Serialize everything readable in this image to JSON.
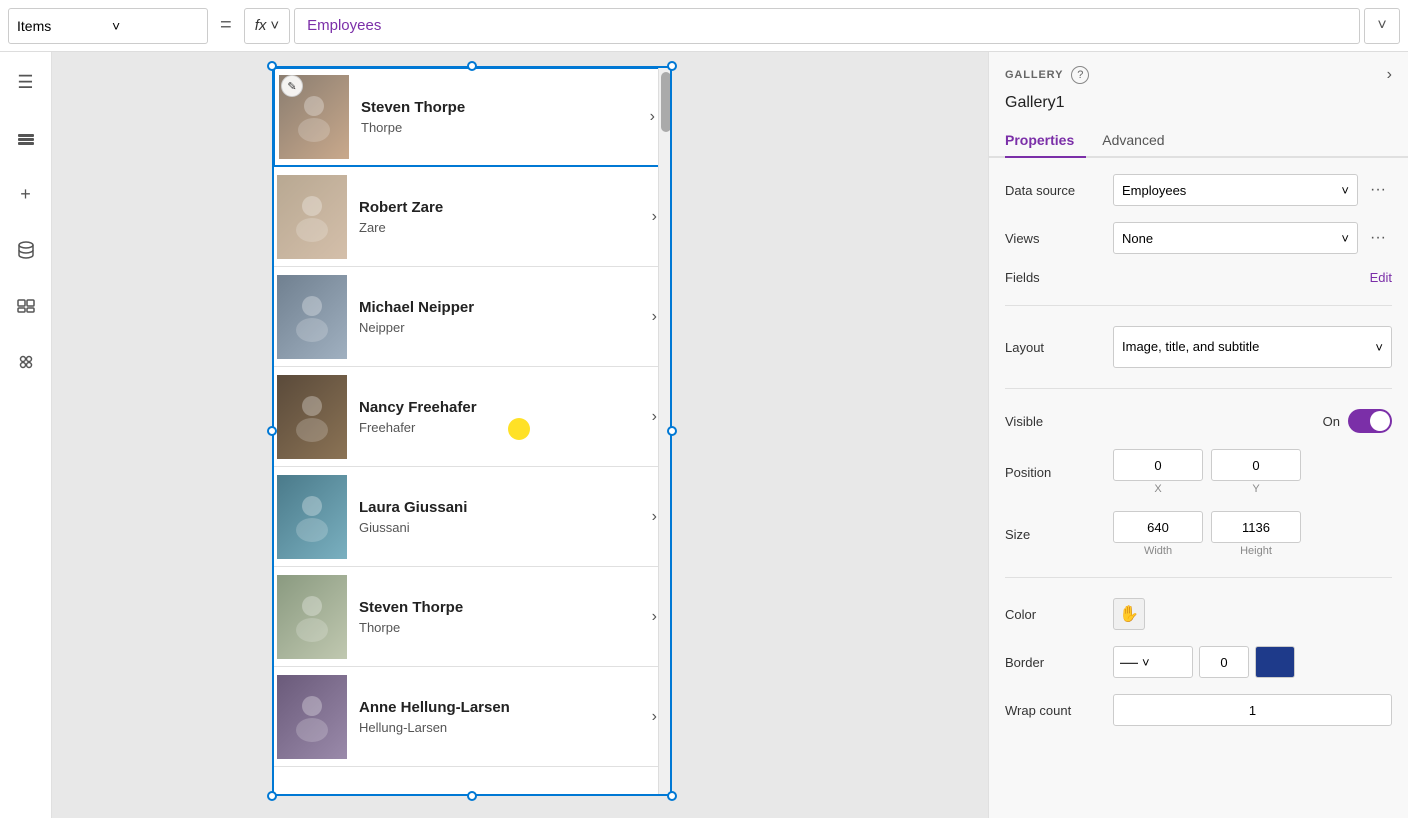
{
  "toolbar": {
    "items_label": "Items",
    "equals_symbol": "=",
    "fx_label": "fx",
    "formula_value": "Employees",
    "chevron_down": "˅"
  },
  "sidebar": {
    "icons": [
      {
        "name": "menu-icon",
        "glyph": "☰"
      },
      {
        "name": "layers-icon",
        "glyph": "⧉"
      },
      {
        "name": "add-icon",
        "glyph": "+"
      },
      {
        "name": "database-icon",
        "glyph": "🗄"
      },
      {
        "name": "media-icon",
        "glyph": "▦"
      },
      {
        "name": "tools-icon",
        "glyph": "🔧"
      }
    ]
  },
  "gallery": {
    "items": [
      {
        "id": 1,
        "title": "Steven Thorpe",
        "subtitle": "Thorpe",
        "color_class": "p1"
      },
      {
        "id": 2,
        "title": "Robert Zare",
        "subtitle": "Zare",
        "color_class": "p2"
      },
      {
        "id": 3,
        "title": "Michael Neipper",
        "subtitle": "Neipper",
        "color_class": "p3"
      },
      {
        "id": 4,
        "title": "Nancy Freehafer",
        "subtitle": "Freehafer",
        "color_class": "p4"
      },
      {
        "id": 5,
        "title": "Laura Giussani",
        "subtitle": "Giussani",
        "color_class": "p5"
      },
      {
        "id": 6,
        "title": "Steven Thorpe",
        "subtitle": "Thorpe",
        "color_class": "p6"
      },
      {
        "id": 7,
        "title": "Anne Hellung-Larsen",
        "subtitle": "Hellung-Larsen",
        "color_class": "p7"
      }
    ]
  },
  "panel": {
    "section_label": "GALLERY",
    "help_icon": "?",
    "expand_icon": "›",
    "component_name": "Gallery1",
    "tabs": [
      {
        "label": "Properties",
        "active": true
      },
      {
        "label": "Advanced",
        "active": false
      }
    ],
    "properties": {
      "data_source_label": "Data source",
      "data_source_value": "Employees",
      "views_label": "Views",
      "views_value": "None",
      "fields_label": "Fields",
      "fields_edit_link": "Edit",
      "layout_label": "Layout",
      "layout_value": "Image, title, and subtitle",
      "visible_label": "Visible",
      "visible_on_label": "On",
      "position_label": "Position",
      "position_x": "0",
      "position_y": "0",
      "position_x_label": "X",
      "position_y_label": "Y",
      "size_label": "Size",
      "size_width": "640",
      "size_height": "1136",
      "size_width_label": "Width",
      "size_height_label": "Height",
      "color_label": "Color",
      "color_icon": "✋",
      "border_label": "Border",
      "border_value": "0",
      "wrap_count_label": "Wrap count",
      "wrap_count_value": "1"
    }
  }
}
